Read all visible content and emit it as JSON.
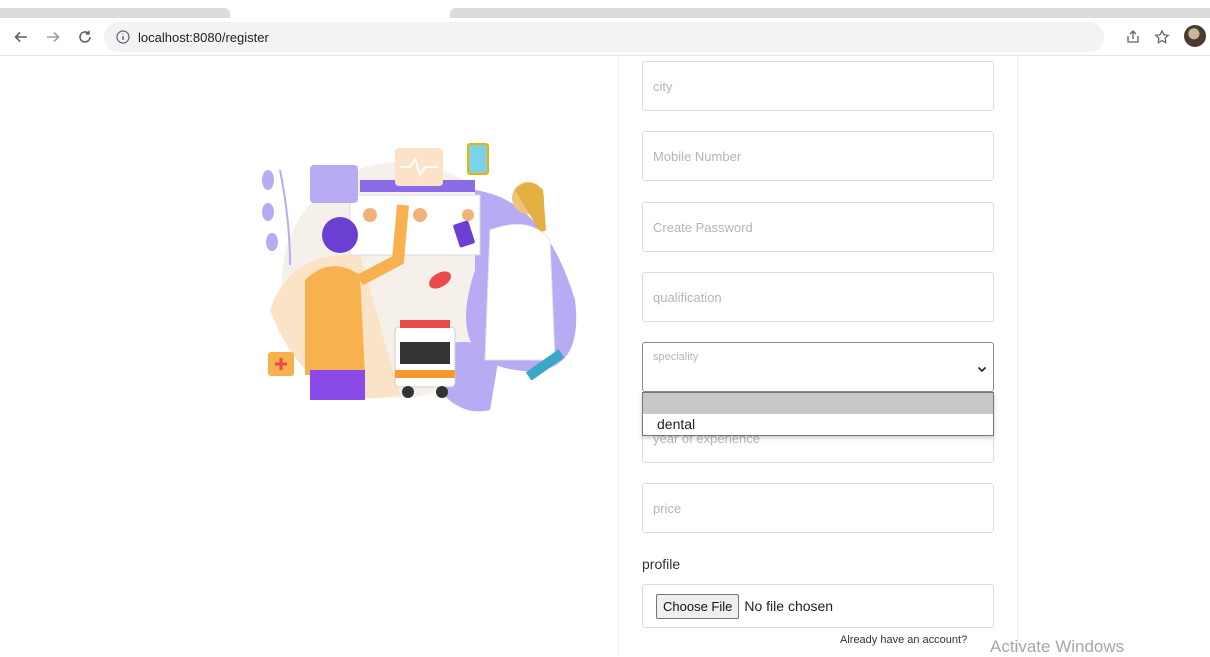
{
  "browser": {
    "url": "localhost:8080/register"
  },
  "form": {
    "city_placeholder": "city",
    "mobile_placeholder": "Mobile Number",
    "password_placeholder": "Create Password",
    "qualification_placeholder": "qualification",
    "speciality": {
      "selected": "speciality",
      "options": [
        "",
        "dental"
      ]
    },
    "experience_placeholder": "year of experience",
    "price_placeholder": "price",
    "profile_label": "profile",
    "file": {
      "button_label": "Choose File",
      "status": "No file chosen"
    },
    "login_link": "Already have an account?"
  },
  "os": {
    "watermark": "Activate Windows"
  }
}
